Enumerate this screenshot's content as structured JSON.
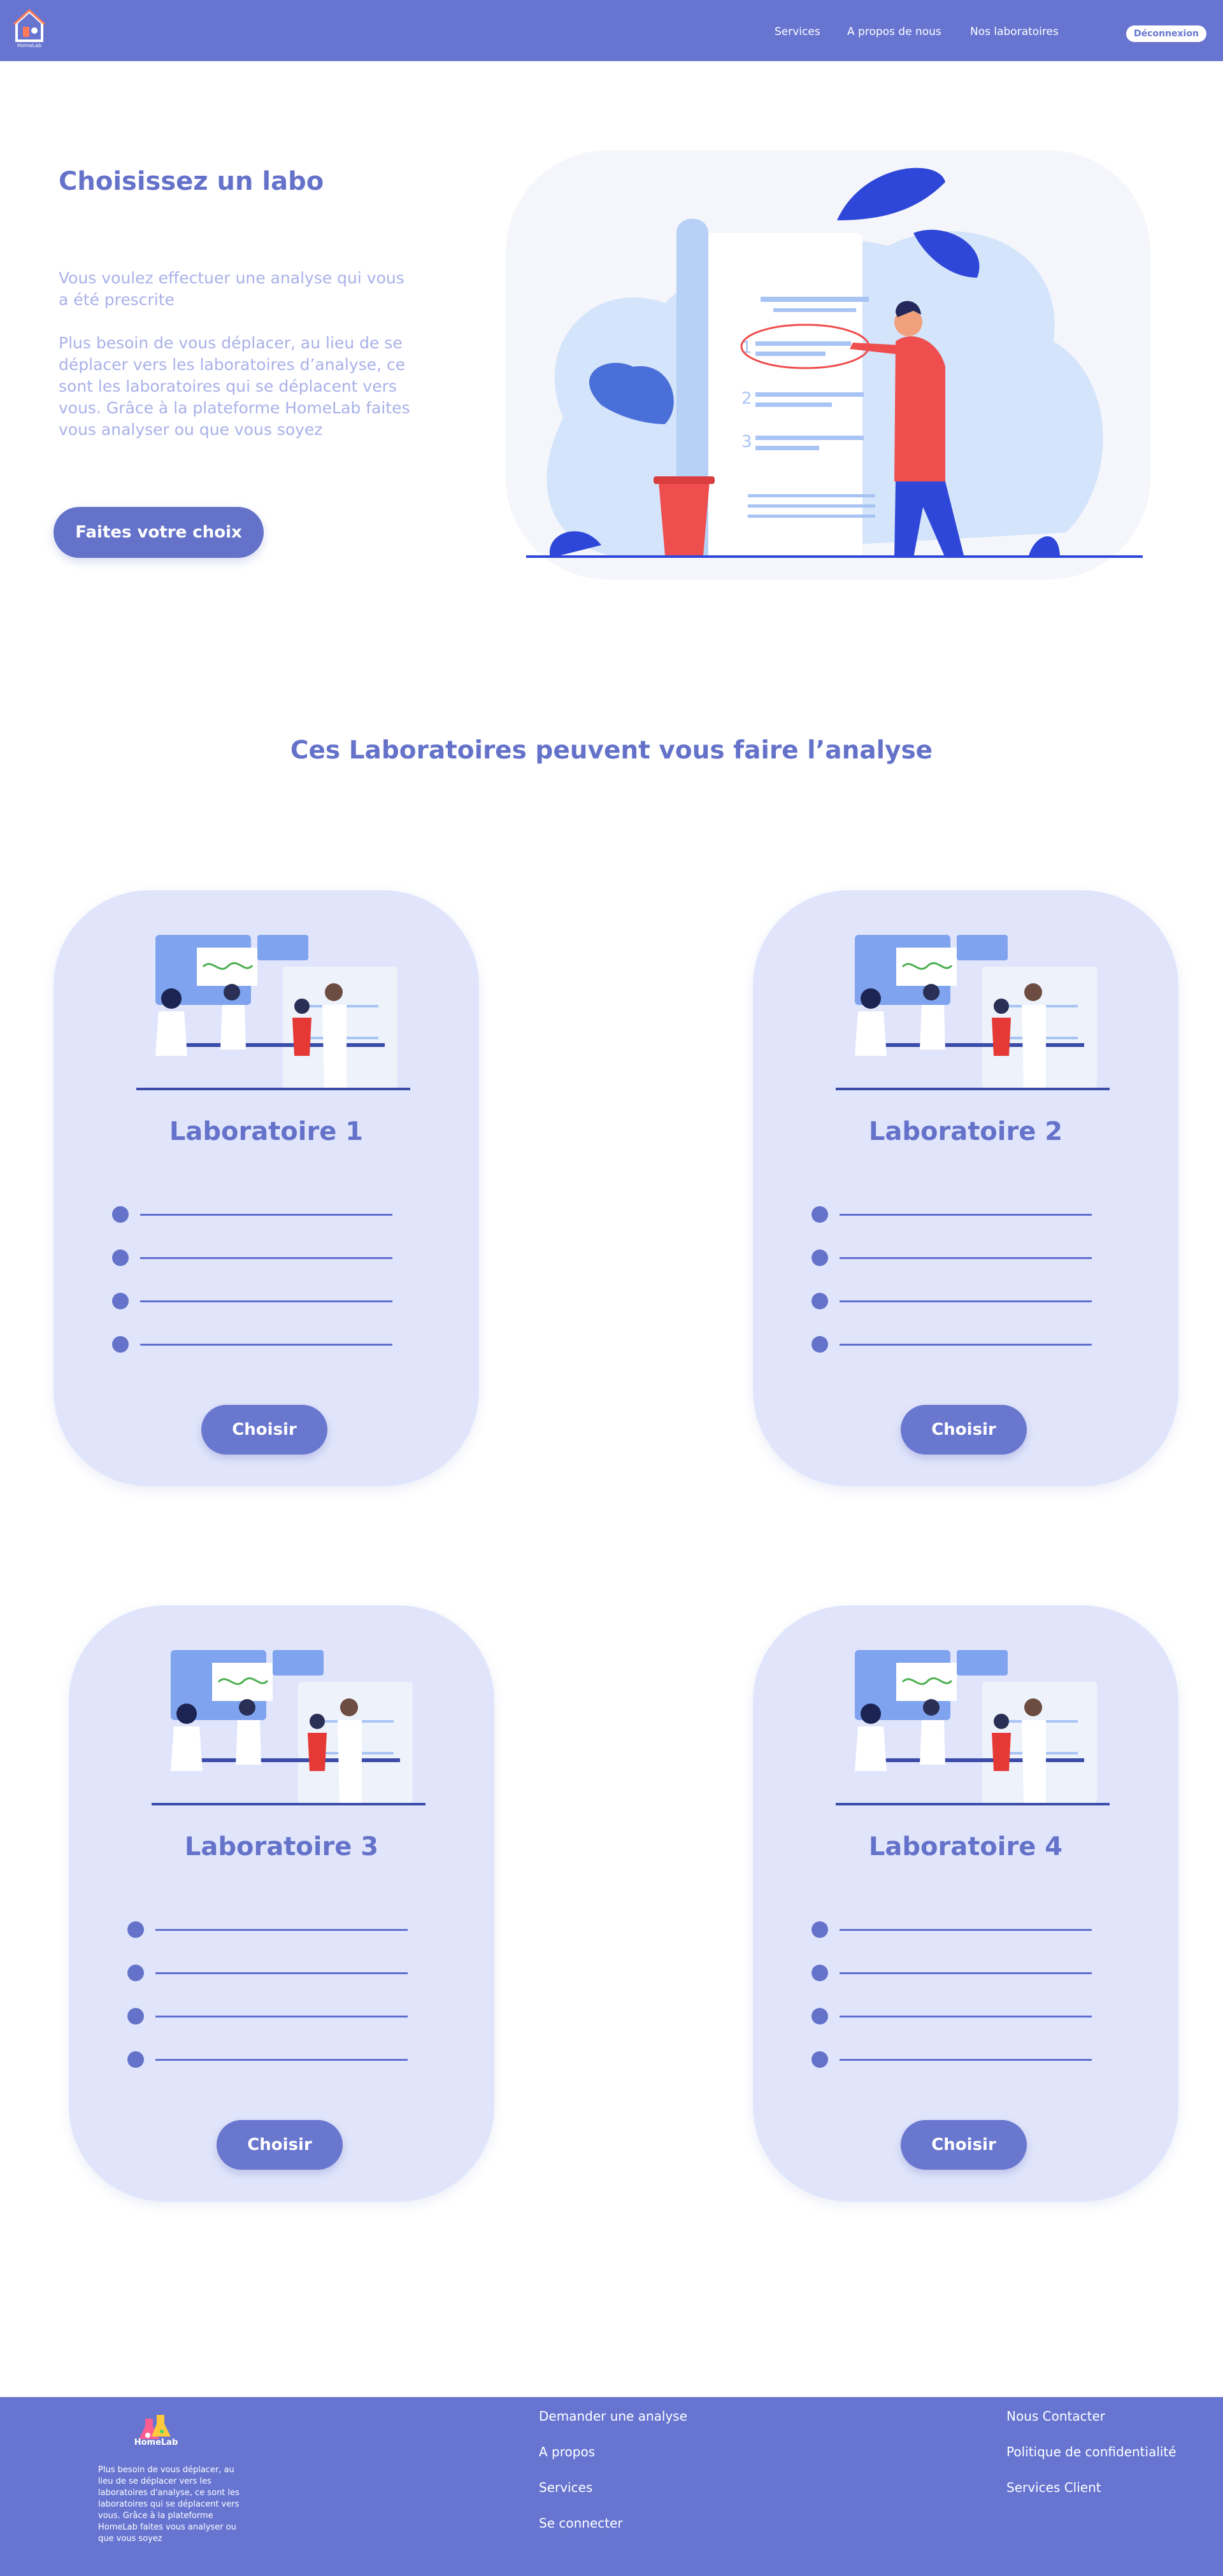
{
  "header": {
    "nav": [
      "Services",
      "A propos de nous",
      "Nos laboratoires"
    ],
    "logout_label": "Déconnexion",
    "logo_caption": "HomeLab"
  },
  "hero": {
    "title": "Choisissez un labo",
    "paragraph_1": "Vous voulez effectuer une analyse qui vous a été prescrite",
    "paragraph_2": "Plus besoin de vous déplacer, au lieu de se déplacer vers les laboratoires d’analyse, ce sont les laboratoires qui se déplacent vers vous. Grâce à la plateforme HomeLab faites vous analyser ou que vous soyez",
    "cta_label": "Faites votre choix",
    "list_numbers": [
      "1",
      "2",
      "3"
    ]
  },
  "section": {
    "title": "Ces  Laboratoires peuvent vous faire l’analyse"
  },
  "labs": [
    {
      "name": "Laboratoire 1",
      "button": "Choisir",
      "feature_count": 4
    },
    {
      "name": "Laboratoire 2",
      "button": "Choisir",
      "feature_count": 4
    },
    {
      "name": "Laboratoire 3",
      "button": "Choisir",
      "feature_count": 4
    },
    {
      "name": "Laboratoire 4",
      "button": "Choisir",
      "feature_count": 4
    }
  ],
  "footer": {
    "brand": "HomeLab",
    "description": "Plus besoin de vous déplacer, au lieu de se déplacer vers les laboratoires d'analyse, ce sont les laboratoires qui se déplacent vers vous. Grâce à la plateforme HomeLab faites vous analyser ou que vous soyez",
    "column_1": [
      "Demander une analyse",
      "A propos",
      "Services",
      "Se connecter"
    ],
    "column_2": [
      "Nous Contacter",
      "Politique de confidentialité",
      "Services Client"
    ]
  },
  "colors": {
    "primary": "#6775d1",
    "heading": "#6472c9",
    "muted_text": "#a9b1e8",
    "card_bg": "#e0e5fb"
  },
  "icons": [
    "homelab-logo-icon",
    "flask-logo-icon"
  ]
}
